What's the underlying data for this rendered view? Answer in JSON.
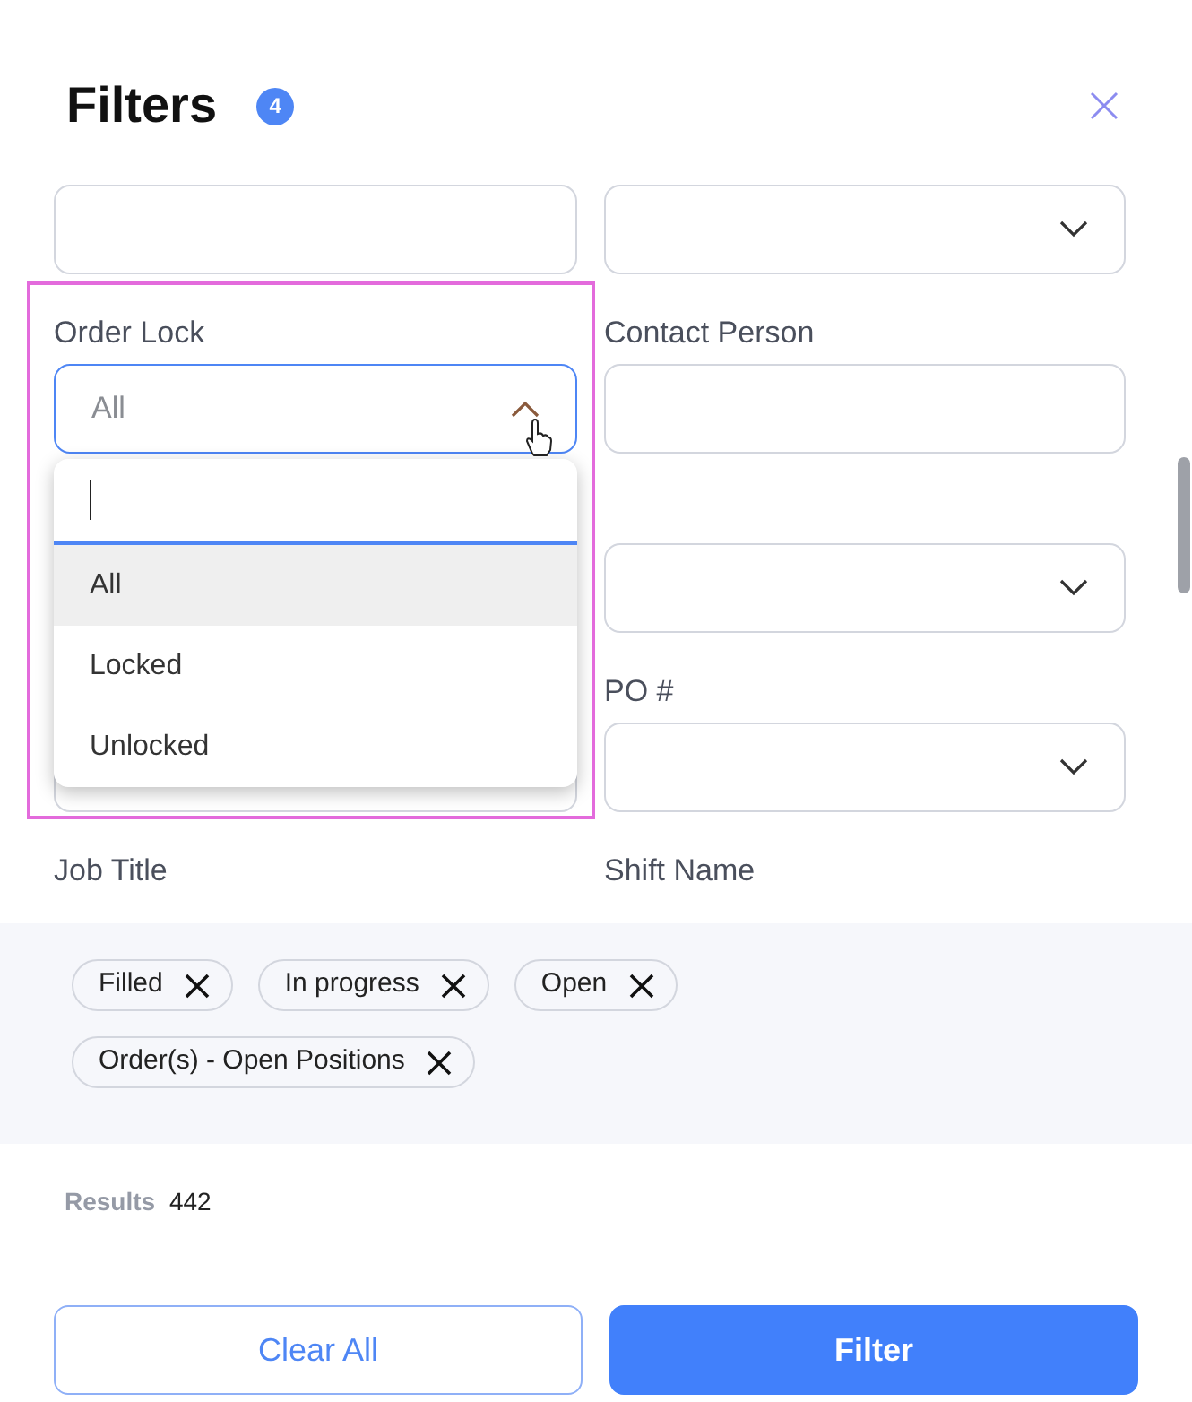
{
  "title": "Filters",
  "count_badge": "4",
  "fields": [
    {
      "kind": "input"
    },
    {
      "kind": "select"
    },
    {
      "kind": "select",
      "label": "Order Lock",
      "placeholder": "All",
      "expanded": true,
      "highlighted": true
    },
    {
      "kind": "input",
      "label": "Contact Person"
    },
    {
      "kind": "hidden"
    },
    {
      "kind": "select"
    },
    {
      "kind": "input"
    },
    {
      "kind": "select",
      "label": "PO #"
    },
    {
      "kind": "label_only",
      "label": "Job Title"
    },
    {
      "kind": "label_only",
      "label": "Shift Name"
    }
  ],
  "dropdown": {
    "options": [
      {
        "label": "All",
        "selected": true
      },
      {
        "label": "Locked",
        "selected": false
      },
      {
        "label": "Unlocked",
        "selected": false
      }
    ]
  },
  "chips": [
    {
      "label": "Filled"
    },
    {
      "label": "In progress"
    },
    {
      "label": "Open"
    },
    {
      "label": "Order(s) - Open Positions"
    }
  ],
  "results": {
    "label": "Results",
    "value": "442"
  },
  "buttons": [
    {
      "label": "Clear All",
      "kind": "outline"
    },
    {
      "label": "Filter",
      "kind": "primary"
    }
  ]
}
